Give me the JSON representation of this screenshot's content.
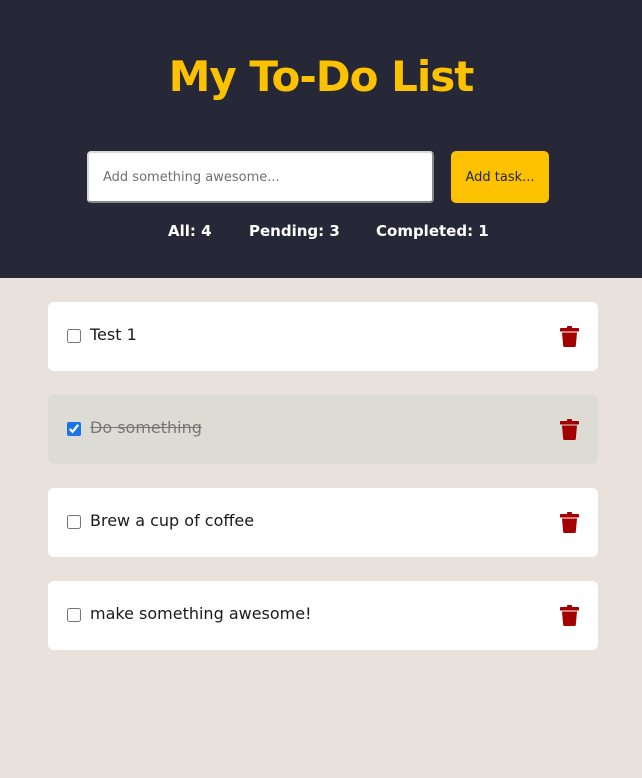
{
  "header": {
    "title": "My To-Do List",
    "input_placeholder": "Add something awesome...",
    "input_value": "",
    "add_button_label": "Add task...",
    "stats": {
      "all": "All: 4",
      "pending": "Pending: 3",
      "completed": "Completed: 1"
    }
  },
  "tasks": [
    {
      "text": "Test 1",
      "completed": false
    },
    {
      "text": "Do something",
      "completed": true
    },
    {
      "text": "Brew a cup of coffee",
      "completed": false
    },
    {
      "text": "make something awesome!",
      "completed": false
    }
  ],
  "icons": {
    "delete": "trash-icon"
  },
  "colors": {
    "header_bg": "#262837",
    "accent": "#fcc200",
    "page_bg": "#e9e1dc",
    "completed_task_bg": "#dddcd4",
    "delete_icon": "#a30000"
  }
}
